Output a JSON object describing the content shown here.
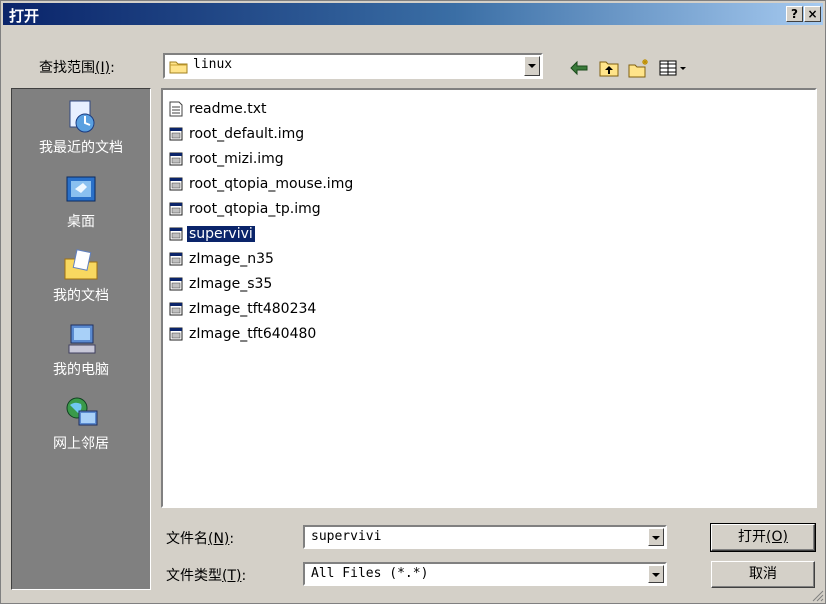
{
  "window": {
    "title": "打开",
    "help_label": "?",
    "close_label": "×"
  },
  "lookin": {
    "label_main": "查找范围",
    "label_key": "(I)",
    "label_colon": ":",
    "value": "linux"
  },
  "places": [
    {
      "label": "我最近的文档",
      "icon": "recent-documents-icon"
    },
    {
      "label": "桌面",
      "icon": "desktop-icon"
    },
    {
      "label": "我的文档",
      "icon": "my-documents-icon"
    },
    {
      "label": "我的电脑",
      "icon": "my-computer-icon"
    },
    {
      "label": "网上邻居",
      "icon": "network-places-icon"
    }
  ],
  "files": [
    {
      "name": "readme.txt",
      "icon": "text-file-icon",
      "selected": false
    },
    {
      "name": "root_default.img",
      "icon": "file-icon",
      "selected": false
    },
    {
      "name": "root_mizi.img",
      "icon": "file-icon",
      "selected": false
    },
    {
      "name": "root_qtopia_mouse.img",
      "icon": "file-icon",
      "selected": false
    },
    {
      "name": "root_qtopia_tp.img",
      "icon": "file-icon",
      "selected": false
    },
    {
      "name": "supervivi",
      "icon": "file-icon",
      "selected": true
    },
    {
      "name": "zImage_n35",
      "icon": "file-icon",
      "selected": false
    },
    {
      "name": "zImage_s35",
      "icon": "file-icon",
      "selected": false
    },
    {
      "name": "zImage_tft480234",
      "icon": "file-icon",
      "selected": false
    },
    {
      "name": "zImage_tft640480",
      "icon": "file-icon",
      "selected": false
    }
  ],
  "filename": {
    "label_main": "文件名",
    "label_key": "(N)",
    "label_colon": ":",
    "value": "supervivi"
  },
  "filetype": {
    "label_main": "文件类型",
    "label_key": "(T)",
    "label_colon": ":",
    "value": "All Files (*.*)"
  },
  "buttons": {
    "open_main": "打开",
    "open_key": "(O)",
    "cancel": "取消"
  },
  "colors": {
    "title_start": "#0a246a",
    "title_end": "#a6caf0",
    "face": "#d4d0c8",
    "places_bg": "#808080",
    "selection": "#0a246a"
  }
}
